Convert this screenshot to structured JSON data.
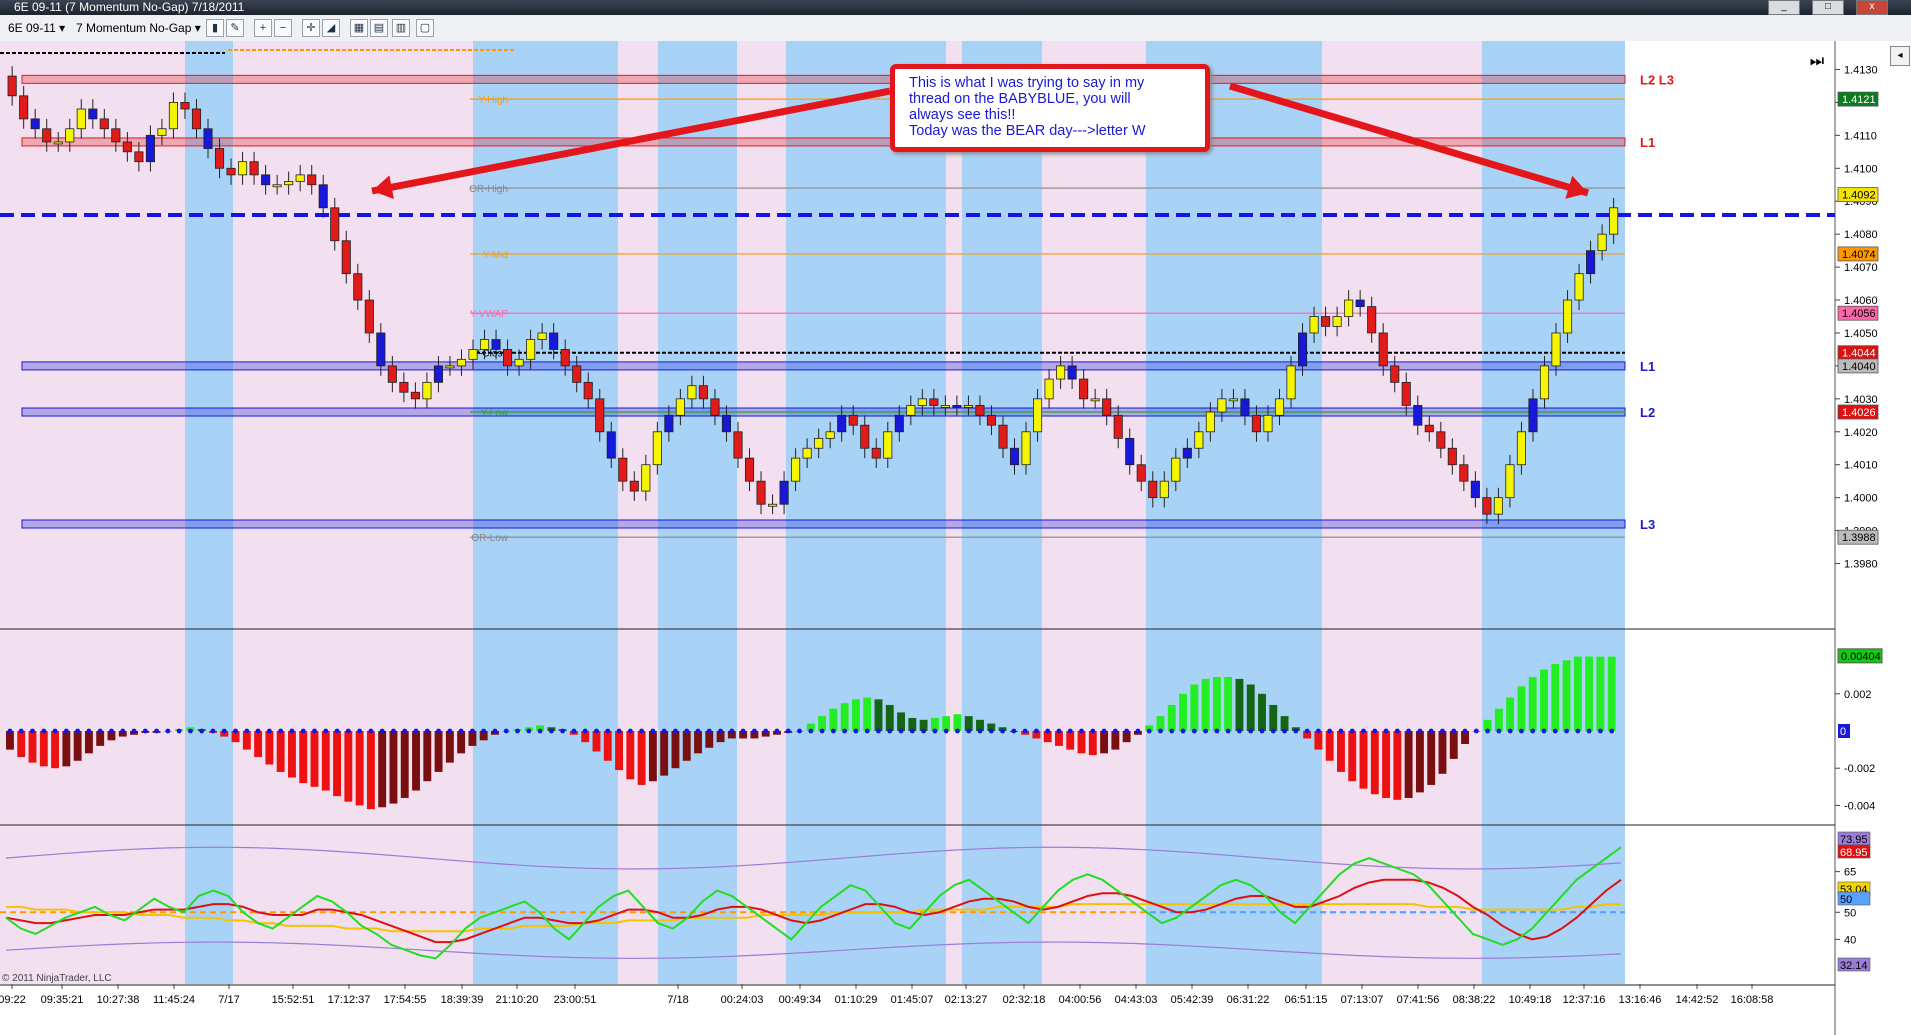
{
  "window": {
    "title": "6E 09-11 (7 Momentum No-Gap)  7/18/2011",
    "buttons": [
      "_",
      "□",
      "x"
    ]
  },
  "toolbar": {
    "instrument": "6E 09-11",
    "bar_type": "7 Momentum No-Gap"
  },
  "annotation": {
    "lines": [
      "This is what I was trying to say in my",
      "thread on the BABYBLUE, you will",
      "always see this!!",
      "Today was the BEAR day--->letter W"
    ]
  },
  "copyright": "© 2011 NinjaTrader, LLC",
  "chart_data": [
    {
      "type": "candlestick",
      "x_labels": [
        "09:22",
        "09:35:21",
        "10:27:38",
        "11:45:24",
        "7/17",
        "15:52:51",
        "17:12:37",
        "17:54:55",
        "18:39:39",
        "21:10:20",
        "23:00:51",
        "7/18",
        "00:24:03",
        "00:49:34",
        "01:10:29",
        "01:45:07",
        "02:13:27",
        "02:32:18",
        "04:00:56",
        "04:43:03",
        "05:42:39",
        "06:31:22",
        "06:51:15",
        "07:13:07",
        "07:41:56",
        "08:38:22",
        "10:49:18",
        "12:37:16",
        "13:16:46",
        "14:42:52",
        "16:08:58"
      ],
      "y_ticks": [
        "1.4130",
        "1.4120",
        "1.4110",
        "1.4100",
        "1.4090",
        "1.4080",
        "1.4070",
        "1.4060",
        "1.4050",
        "1.4040",
        "1.4030",
        "1.4020",
        "1.4010",
        "1.4000",
        "1.3990",
        "1.3980"
      ],
      "ylim": [
        1.3975,
        1.4135
      ],
      "closes": [
        1.4122,
        1.4115,
        1.4112,
        1.4108,
        1.4108,
        1.4112,
        1.4118,
        1.4115,
        1.4112,
        1.4108,
        1.4105,
        1.4102,
        1.411,
        1.4112,
        1.412,
        1.4118,
        1.4112,
        1.4106,
        1.41,
        1.4098,
        1.4102,
        1.4098,
        1.4095,
        1.4095,
        1.4096,
        1.4098,
        1.4095,
        1.4088,
        1.4078,
        1.4068,
        1.406,
        1.405,
        1.404,
        1.4035,
        1.4032,
        1.403,
        1.4035,
        1.404,
        1.404,
        1.4042,
        1.4045,
        1.4048,
        1.4045,
        1.404,
        1.4042,
        1.4048,
        1.405,
        1.4045,
        1.404,
        1.4035,
        1.403,
        1.402,
        1.4012,
        1.4005,
        1.4002,
        1.401,
        1.402,
        1.4025,
        1.403,
        1.4034,
        1.403,
        1.4025,
        1.402,
        1.4012,
        1.4005,
        1.3998,
        1.3998,
        1.4005,
        1.4012,
        1.4015,
        1.4018,
        1.402,
        1.4025,
        1.4022,
        1.4015,
        1.4012,
        1.402,
        1.4025,
        1.4028,
        1.403,
        1.4028,
        1.4028,
        1.4028,
        1.4028,
        1.4025,
        1.4022,
        1.4015,
        1.401,
        1.402,
        1.403,
        1.4036,
        1.404,
        1.4036,
        1.403,
        1.403,
        1.4025,
        1.4018,
        1.401,
        1.4005,
        1.4,
        1.4005,
        1.4012,
        1.4015,
        1.402,
        1.4026,
        1.403,
        1.403,
        1.4025,
        1.402,
        1.4025,
        1.403,
        1.404,
        1.405,
        1.4055,
        1.4052,
        1.4055,
        1.406,
        1.4058,
        1.405,
        1.404,
        1.4035,
        1.4028,
        1.4022,
        1.402,
        1.4015,
        1.401,
        1.4005,
        1.4,
        1.3995,
        1.4,
        1.401,
        1.402,
        1.403,
        1.404,
        1.405,
        1.406,
        1.4068,
        1.4075,
        1.408,
        1.4088
      ],
      "levels": [
        {
          "label": "L2 L3",
          "price": 1.4127,
          "color": "#e31a1a",
          "kind": "red-band"
        },
        {
          "label": "L1",
          "price": 1.4108,
          "color": "#e31a1a",
          "kind": "red-band"
        },
        {
          "label": "L1",
          "price": 1.404,
          "color": "#1a1ad6",
          "kind": "blue-band"
        },
        {
          "label": "L2",
          "price": 1.4026,
          "color": "#1a1ad6",
          "kind": "blue-band"
        },
        {
          "label": "L3",
          "price": 1.3992,
          "color": "#1a1ad6",
          "kind": "blue-band"
        }
      ],
      "reference_lines": [
        {
          "label": "Y-High",
          "price": 1.4121,
          "color": "#ff9900"
        },
        {
          "label": "OR-High",
          "price": 1.4094,
          "color": "#888888"
        },
        {
          "label": "Y-Mid",
          "price": 1.4074,
          "color": "#ff9900"
        },
        {
          "label": "Y-VWAP",
          "price": 1.4056,
          "color": "#ff66aa"
        },
        {
          "label": "Y-Close",
          "price": 1.4044,
          "color": "#000000"
        },
        {
          "label": "Y-Low",
          "price": 1.4026,
          "color": "#22aa22"
        },
        {
          "label": "OR-Low",
          "price": 1.3988,
          "color": "#888888"
        }
      ],
      "price_labels": [
        {
          "text": "1.4121",
          "price": 1.4121,
          "color": "#0b7d1e"
        },
        {
          "text": "1.4092",
          "price": 1.4092,
          "color": "#f5e400"
        },
        {
          "text": "1.4074",
          "price": 1.4074,
          "color": "#ff9900"
        },
        {
          "text": "1.4056",
          "price": 1.4056,
          "color": "#ff66aa"
        },
        {
          "text": "1.4044",
          "price": 1.4044,
          "color": "#dd1111"
        },
        {
          "text": "1.4040",
          "price": 1.404,
          "color": "#bbbbbb"
        },
        {
          "text": "1.4026",
          "price": 1.4026,
          "color": "#dd1111"
        },
        {
          "text": "1.3988",
          "price": 1.3988,
          "color": "#bbbbbb"
        }
      ]
    },
    {
      "type": "bar",
      "name": "momentum histogram",
      "y_ticks": [
        "0.002",
        "-0.002",
        "-0.004"
      ],
      "ylim": [
        -0.0048,
        0.0045
      ],
      "current_labels": [
        {
          "text": "0.00404",
          "color": "#11cc11"
        },
        {
          "text": "0",
          "color": "#1a1ad6"
        }
      ],
      "values": [
        -0.001,
        -0.0014,
        -0.0017,
        -0.0019,
        -0.002,
        -0.0019,
        -0.0016,
        -0.0012,
        -0.0008,
        -0.0005,
        -0.0003,
        -0.0002,
        -0.0001,
        -0.0001,
        0.0,
        0.0001,
        0.0002,
        0.0001,
        -0.0001,
        -0.0003,
        -0.0006,
        -0.001,
        -0.0014,
        -0.0018,
        -0.0022,
        -0.0025,
        -0.0028,
        -0.003,
        -0.0032,
        -0.0035,
        -0.0038,
        -0.004,
        -0.0042,
        -0.0041,
        -0.0039,
        -0.0036,
        -0.0032,
        -0.0027,
        -0.0022,
        -0.0017,
        -0.0012,
        -0.0008,
        -0.0005,
        -0.0002,
        0.0,
        0.0001,
        0.0002,
        0.0003,
        0.0002,
        0.0001,
        -0.0002,
        -0.0006,
        -0.0011,
        -0.0016,
        -0.0021,
        -0.0026,
        -0.0029,
        -0.0027,
        -0.0024,
        -0.002,
        -0.0016,
        -0.0012,
        -0.0009,
        -0.0006,
        -0.0004,
        -0.0004,
        -0.0004,
        -0.0003,
        -0.0002,
        -0.0001,
        0.0,
        0.0004,
        0.0008,
        0.0012,
        0.0015,
        0.0017,
        0.0018,
        0.0017,
        0.0014,
        0.001,
        0.0007,
        0.0006,
        0.0007,
        0.0008,
        0.0009,
        0.0008,
        0.0006,
        0.0004,
        0.0002,
        0.0,
        -0.0002,
        -0.0004,
        -0.0006,
        -0.0008,
        -0.001,
        -0.0012,
        -0.0013,
        -0.0012,
        -0.001,
        -0.0006,
        -0.0002,
        0.0003,
        0.0008,
        0.0014,
        0.002,
        0.0025,
        0.0028,
        0.0029,
        0.0029,
        0.0028,
        0.0025,
        0.002,
        0.0014,
        0.0008,
        0.0002,
        -0.0004,
        -0.001,
        -0.0016,
        -0.0022,
        -0.0027,
        -0.0031,
        -0.0034,
        -0.0036,
        -0.0037,
        -0.0036,
        -0.0033,
        -0.0029,
        -0.0023,
        -0.0015,
        -0.0007,
        0.0,
        0.0006,
        0.0012,
        0.0018,
        0.0024,
        0.0029,
        0.0033,
        0.0036,
        0.0038,
        0.004,
        0.004,
        0.004,
        0.004
      ]
    },
    {
      "type": "line",
      "name": "oscillator",
      "y_ticks": [
        "65",
        "50",
        "40"
      ],
      "ylim": [
        25,
        80
      ],
      "current_labels": [
        {
          "text": "73.95",
          "color": "#9b7cd6"
        },
        {
          "text": "68.95",
          "color": "#dd1111"
        },
        {
          "text": "53.04",
          "color": "#f5d800"
        },
        {
          "text": "50",
          "color": "#5aa0ff"
        },
        {
          "text": "32.14",
          "color": "#9b7cd6"
        }
      ],
      "series": [
        {
          "color": "#22dd22",
          "values": [
            48,
            44,
            42,
            45,
            48,
            50,
            52,
            49,
            47,
            51,
            55,
            52,
            50,
            56,
            58,
            56,
            50,
            46,
            44,
            48,
            52,
            56,
            54,
            50,
            45,
            42,
            38,
            36,
            34,
            33,
            38,
            44,
            48,
            50,
            52,
            54,
            50,
            44,
            40,
            46,
            52,
            56,
            58,
            52,
            46,
            44,
            48,
            54,
            58,
            56,
            52,
            48,
            44,
            40,
            46,
            52,
            56,
            60,
            58,
            52,
            46,
            44,
            50,
            56,
            60,
            62,
            58,
            54,
            50,
            46,
            52,
            58,
            62,
            64,
            62,
            58,
            54,
            50,
            46,
            48,
            52,
            56,
            60,
            62,
            60,
            56,
            50,
            46,
            52,
            58,
            64,
            68,
            70,
            68,
            66,
            64,
            60,
            54,
            48,
            42,
            40,
            38,
            40,
            44,
            50,
            56,
            62,
            66,
            70,
            74
          ]
        },
        {
          "color": "#dd1111",
          "values": [
            48,
            47,
            46,
            46,
            47,
            48,
            49,
            49,
            49,
            50,
            51,
            51,
            51,
            52,
            53,
            53,
            52,
            50,
            49,
            49,
            49,
            51,
            51,
            50,
            49,
            47,
            45,
            43,
            41,
            39,
            39,
            40,
            42,
            44,
            46,
            48,
            48,
            47,
            46,
            46,
            47,
            49,
            51,
            51,
            50,
            48,
            48,
            49,
            51,
            52,
            52,
            51,
            49,
            47,
            46,
            47,
            49,
            51,
            53,
            53,
            52,
            50,
            49,
            50,
            52,
            54,
            55,
            55,
            54,
            52,
            51,
            52,
            54,
            56,
            57,
            57,
            56,
            54,
            52,
            50,
            50,
            51,
            53,
            55,
            56,
            56,
            54,
            52,
            52,
            54,
            56,
            59,
            61,
            62,
            62,
            62,
            61,
            59,
            56,
            52,
            49,
            45,
            42,
            40,
            41,
            44,
            48,
            53,
            58,
            62
          ]
        },
        {
          "color": "#f5c400",
          "values": [
            52,
            52,
            51,
            51,
            51,
            50,
            50,
            50,
            50,
            49,
            49,
            49,
            48,
            48,
            48,
            47,
            47,
            46,
            46,
            45,
            45,
            45,
            45,
            44,
            44,
            44,
            43,
            43,
            43,
            43,
            43,
            43,
            44,
            44,
            44,
            45,
            45,
            45,
            45,
            46,
            46,
            46,
            47,
            47,
            47,
            47,
            48,
            48,
            48,
            48,
            48,
            49,
            49,
            49,
            49,
            49,
            50,
            50,
            50,
            50,
            50,
            50,
            51,
            51,
            51,
            51,
            51,
            52,
            52,
            52,
            52,
            52,
            53,
            53,
            53,
            53,
            53,
            53,
            53,
            53,
            53,
            53,
            53,
            53,
            53,
            53,
            53,
            53,
            53,
            53,
            53,
            53,
            53,
            53,
            53,
            53,
            52,
            52,
            52,
            51,
            51,
            51,
            51,
            51,
            51,
            51,
            52,
            52,
            53,
            53
          ]
        }
      ],
      "bands": {
        "upper": 74,
        "lower": 32,
        "color": "#9b7cd6"
      },
      "reference": {
        "value": 50,
        "color": "#ff9900"
      }
    }
  ]
}
